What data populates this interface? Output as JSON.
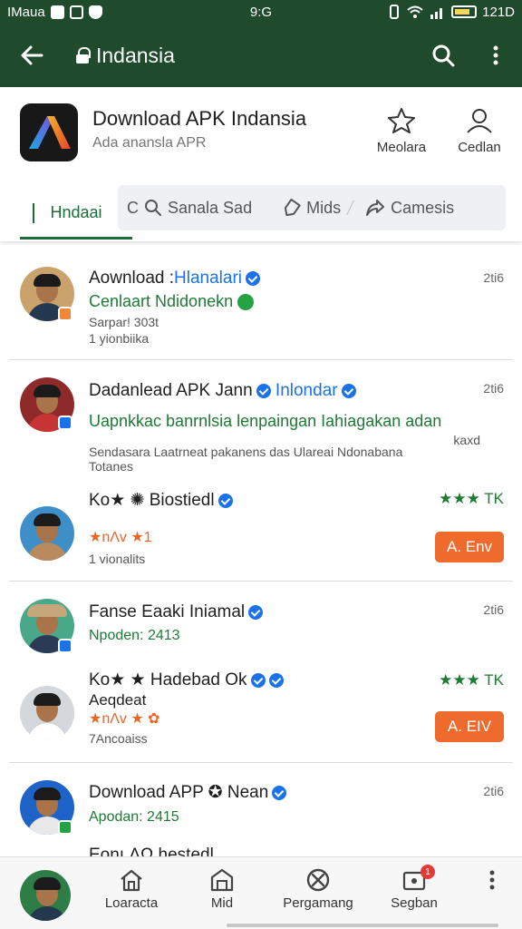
{
  "status_bar": {
    "carrier": "IMaua",
    "time": "9:G",
    "battery": "121D"
  },
  "app_bar": {
    "title": "Indansia",
    "back_icon": "arrow-left-icon",
    "search_icon": "search-icon",
    "more_icon": "more-vertical-icon"
  },
  "header": {
    "app_name": "Download APK Indansia",
    "app_subtitle": "Ada anansla APR",
    "actions": [
      {
        "label": "Meolara",
        "icon": "star-icon"
      },
      {
        "label": "Cedlan",
        "icon": "person-icon"
      }
    ],
    "tabs": {
      "home": "Hndaai",
      "search_prefix": "C",
      "search": "Sanala Sad",
      "mids": "Mids",
      "camesis": "Camesis"
    }
  },
  "posts": [
    {
      "name": "Aownload :",
      "handle": "Hlanalari",
      "line": "Cenlaart Ndidonekn",
      "meta1": "Sarpar! 303t",
      "meta2": "1 yionbiika",
      "time": "2ti6"
    },
    {
      "name": "Dadanlead APK Jann",
      "handle": "Inlondar",
      "line": "Uapnkkac banrnlsia lenpaingan Iahiagakan adan",
      "meta0": "kaxd",
      "meta1": "Sendasara Laatrneat pakanens das Ulareai Ndonabana",
      "meta2": "Totanes",
      "time": "2ti6"
    },
    {
      "name": "Ko★ ✺ Biostiedl",
      "stars_text": "★★★ TK",
      "rating_line": "★ ★ ★ ⋆ 1",
      "rating_text": "★nɅv ★1",
      "meta2": "1 vionalits",
      "cta": "A. Env"
    },
    {
      "name": "Fanse Eaaki Iniamal",
      "line": "Npoden: 2413",
      "time": "2ti6"
    },
    {
      "name": "Ko★ ★ Hadebad Ok",
      "line2": "Aeqdeat",
      "stars_text": "★★★ TK",
      "rating_text": "★nɅv ★ ✿",
      "meta2": "7Ancoaiss",
      "cta": "A. EIV"
    },
    {
      "name": "Download APP ✪ Nean",
      "line": "Apodan: 2415",
      "time": "2ti6"
    },
    {
      "name": "Eonı ɅΩ hestedl ..."
    }
  ],
  "bottom_nav": [
    {
      "label": "Loaracta",
      "icon": "home-icon"
    },
    {
      "label": "Mid",
      "icon": "store-icon"
    },
    {
      "label": "Pergamang",
      "icon": "blocked-icon"
    },
    {
      "label": "Segban",
      "icon": "notification-icon",
      "badge": "1"
    }
  ],
  "colors": {
    "primary": "#1f4a2c",
    "accent_green": "#1e7a35",
    "link_blue": "#1a73e8",
    "cta_orange": "#ee6a2d"
  }
}
